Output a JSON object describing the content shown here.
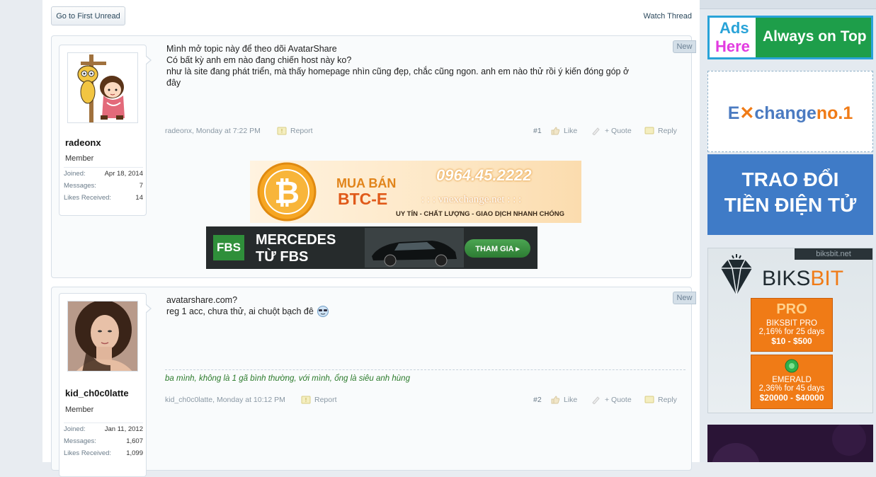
{
  "toolbar": {
    "first_unread": "Go to First Unread",
    "watch_thread": "Watch Thread"
  },
  "posts": [
    {
      "username": "radeonx",
      "user_title": "Member",
      "joined_label": "Joined:",
      "joined": "Apr 18, 2014",
      "messages_label": "Messages:",
      "messages": "7",
      "likes_label": "Likes Received:",
      "likes": "14",
      "new_badge": "New",
      "lines": [
        "Mình mở topic này để theo dõi AvatarShare",
        "Có bất kỳ anh em nào đang chiến host này ko?",
        "như là site đang phát triển, mà thấy homepage nhìn cũng đẹp, chắc cũng ngon. anh em nào thử rồi ý kiến đóng góp ở",
        "đây"
      ],
      "meta_date": "radeonx, Monday at 7:22 PM",
      "report": "Report",
      "number": "#1",
      "like": "Like",
      "quote": "+ Quote",
      "reply": "Reply"
    },
    {
      "username": "kid_ch0c0latte",
      "user_title": "Member",
      "joined_label": "Joined:",
      "joined": "Jan 11, 2012",
      "messages_label": "Messages:",
      "messages": "1,607",
      "likes_label": "Likes Received:",
      "likes": "1,099",
      "new_badge": "New",
      "lines": [
        "avatarshare.com?",
        "reg 1 acc, chưa thử, ai chuột bạch đê"
      ],
      "signature": "ba mình, không là 1 gã bình thường, với mình, ổng là siêu anh hùng",
      "meta_date": "kid_ch0c0latte, Monday at 10:12 PM",
      "report": "Report",
      "number": "#2",
      "like": "Like",
      "quote": "+ Quote",
      "reply": "Reply"
    }
  ],
  "banners": {
    "btc": {
      "mua_ban": "MUA BÁN",
      "btce": "BTC-E",
      "phone": "0964.45.2222",
      "site": ": : : vnexchange.net : : :",
      "slogan": "UY TÍN - CHẤT LƯỢNG - GIAO DỊCH NHANH CHÓNG"
    },
    "fbs": {
      "logo": "FBS",
      "line1": "MERCEDES",
      "line2": "TỪ FBS",
      "cta": "THAM GIA ▸"
    }
  },
  "sidebar_ads": {
    "ads_here_1": "Ads",
    "ads_here_2": "Here",
    "always_on_top": "Always on Top",
    "exchange_a": "E",
    "exchange_b": "change",
    "exchange_c": "no.1",
    "trao_doi_1": "TRAO ĐỔI",
    "trao_doi_2": "TIỀN ĐIỆN TỬ",
    "biksbit_url": "biksbit.net",
    "biksbit_name_a": "BIKS",
    "biksbit_name_b": "BIT",
    "pro_title": "PRO",
    "pro_line1": "BIKSBIT PRO",
    "pro_line2": "2,16% for 25 days",
    "pro_line3": "$10 - $500",
    "emerald_line1": "EMERALD",
    "emerald_line2": "2,36% for 45 days",
    "emerald_line3": "$20000 - $40000"
  },
  "colors": {
    "accent": "#2b485c",
    "signature": "#2a7a2a",
    "ad_green": "#1e9e4a",
    "ad_blue": "#3f7bc7",
    "biksbit_orange": "#f07b16"
  }
}
